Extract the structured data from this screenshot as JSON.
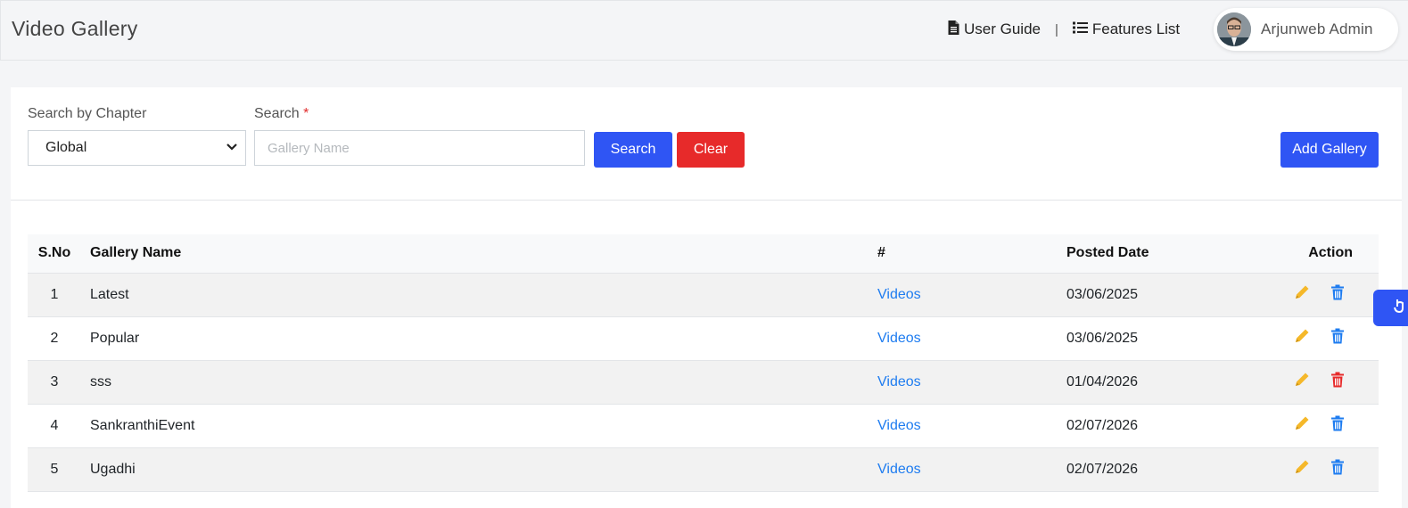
{
  "header": {
    "title": "Video Gallery",
    "user_guide": "User Guide",
    "separator": "|",
    "features_list": "Features List",
    "user_name": "Arjunweb Admin"
  },
  "filters": {
    "chapter_label": "Search by Chapter",
    "chapter_value": "Global",
    "search_label": "Search",
    "search_required_mark": "*",
    "search_placeholder": "Gallery Name",
    "search_button": "Search",
    "clear_button": "Clear",
    "add_button": "Add Gallery"
  },
  "table": {
    "headers": {
      "sno": "S.No",
      "name": "Gallery Name",
      "count": "#",
      "date": "Posted Date",
      "action": "Action"
    },
    "rows": [
      {
        "sno": "1",
        "name": "Latest",
        "link": "Videos",
        "date": "03/06/2025",
        "delete_color": "#1e7cf0"
      },
      {
        "sno": "2",
        "name": "Popular",
        "link": "Videos",
        "date": "03/06/2025",
        "delete_color": "#1e7cf0"
      },
      {
        "sno": "3",
        "name": "sss",
        "link": "Videos",
        "date": "01/04/2026",
        "delete_color": "#e72a2a"
      },
      {
        "sno": "4",
        "name": "SankranthiEvent",
        "link": "Videos",
        "date": "02/07/2026",
        "delete_color": "#1e7cf0"
      },
      {
        "sno": "5",
        "name": "Ugadhi",
        "link": "Videos",
        "date": "02/07/2026",
        "delete_color": "#1e7cf0"
      }
    ]
  },
  "colors": {
    "primary": "#2f55f4",
    "danger": "#e72a2a",
    "link": "#1e7cf0",
    "edit_icon": "#f5b82a"
  },
  "icons": {
    "user_guide": "file-icon",
    "features_list": "list-icon",
    "edit": "pencil-icon",
    "delete": "trash-icon",
    "select": "chevron-down-icon"
  }
}
